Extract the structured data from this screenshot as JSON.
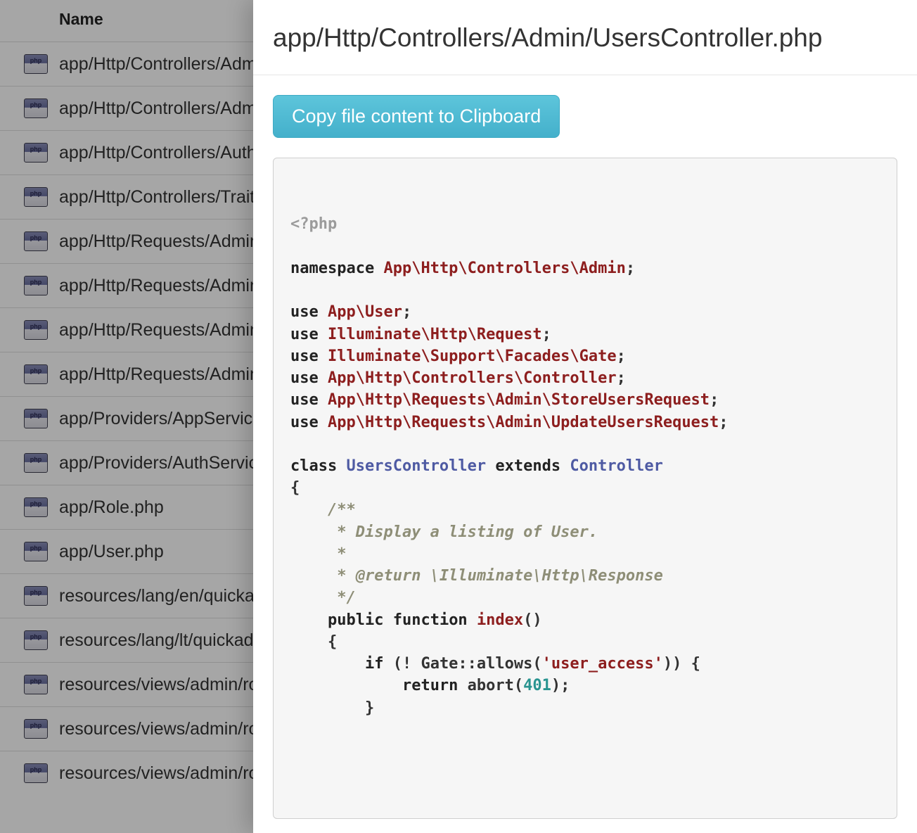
{
  "table": {
    "header": "Name",
    "rows": [
      "app/Http/Controllers/Admin/RolesController.php",
      "app/Http/Controllers/Admin/UsersController.php",
      "app/Http/Controllers/Auth/LoginController.php",
      "app/Http/Controllers/Traits/FileUploadTrait.php",
      "app/Http/Requests/Admin/StoreRolesRequest.php",
      "app/Http/Requests/Admin/StoreUsersRequest.php",
      "app/Http/Requests/Admin/UpdateRolesRequest.php",
      "app/Http/Requests/Admin/UpdateUsersRequest.php",
      "app/Providers/AppServiceProvider.php",
      "app/Providers/AuthServiceProvider.php",
      "app/Role.php",
      "app/User.php",
      "resources/lang/en/quickadmin.php",
      "resources/lang/lt/quickadmin.php",
      "resources/views/admin/roles/create.blade.php",
      "resources/views/admin/roles/edit.blade.php",
      "resources/views/admin/roles/index.blade.php"
    ]
  },
  "modal": {
    "title": "app/Http/Controllers/Admin/UsersController.php",
    "copy_button": "Copy file content to Clipboard",
    "code": {
      "open_tag": "<?php",
      "kw_namespace": "namespace",
      "namespace_val": "App\\Http\\Controllers\\Admin",
      "kw_use": "use",
      "use1": "App\\User",
      "use2": "Illuminate\\Http\\Request",
      "use3": "Illuminate\\Support\\Facades\\Gate",
      "use4": "App\\Http\\Controllers\\Controller",
      "use5": "App\\Http\\Requests\\Admin\\StoreUsersRequest",
      "use6": "App\\Http\\Requests\\Admin\\UpdateUsersRequest",
      "kw_class": "class",
      "class_name": "UsersController",
      "kw_extends": "extends",
      "parent_class": "Controller",
      "doc_open": "/**",
      "doc_l1": "     * Display a listing of User.",
      "doc_l2": "     *",
      "doc_l3a": "     * ",
      "doc_return": "@return",
      "doc_l3b": " \\Illuminate\\Http\\Response",
      "doc_close": "     */",
      "kw_public": "public",
      "kw_function": "function",
      "fn_name": "index",
      "kw_if": "if",
      "if_cond_pre": " (! Gate::allows(",
      "str_user_access": "'user_access'",
      "if_cond_post": ")) {",
      "kw_return": "return",
      "abort_pre": " abort(",
      "num_401": "401",
      "abort_post": ");"
    }
  }
}
